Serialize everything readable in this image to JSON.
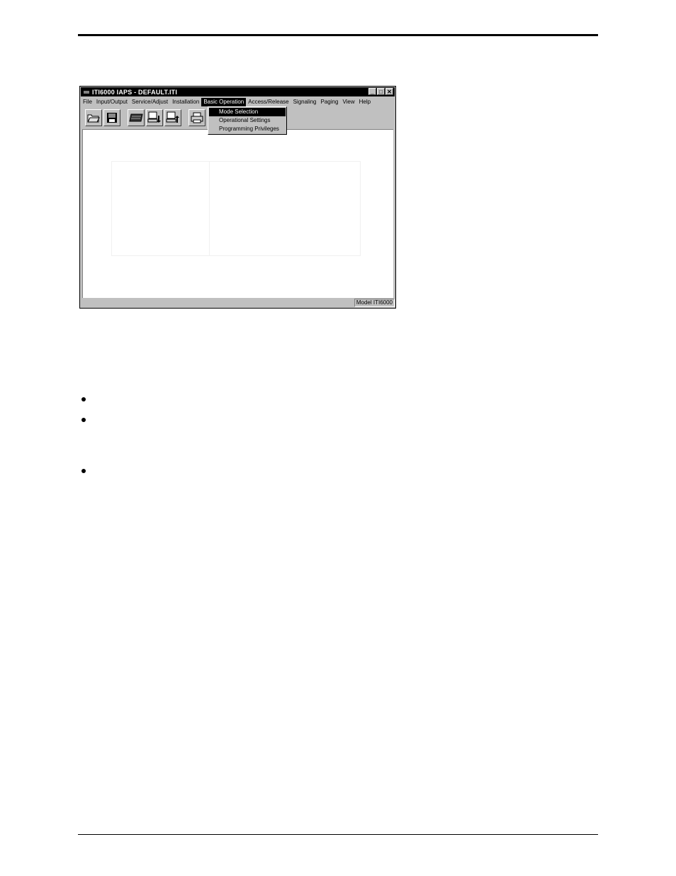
{
  "window": {
    "title": "ITI6000 IAPS - DEFAULT.ITI",
    "controls": {
      "minimize": "_",
      "maximize": "□",
      "close": "✕"
    }
  },
  "menubar": {
    "items": [
      "File",
      "Input/Output",
      "Service/Adjust",
      "Installation",
      "Basic Operation",
      "Access/Release",
      "Signaling",
      "Paging",
      "View",
      "Help"
    ],
    "active_index": 4
  },
  "dropdown": {
    "items": [
      "Mode Selection",
      "Operational Settings",
      "Programming Privileges"
    ],
    "selected_index": 0
  },
  "toolbar": {
    "buttons": [
      "open-folder-icon",
      "save-disk-icon",
      "keyboard-icon",
      "download-computer-icon",
      "upload-computer-icon",
      "print-icon"
    ]
  },
  "statusbar": {
    "model": "Model ITI6000"
  }
}
